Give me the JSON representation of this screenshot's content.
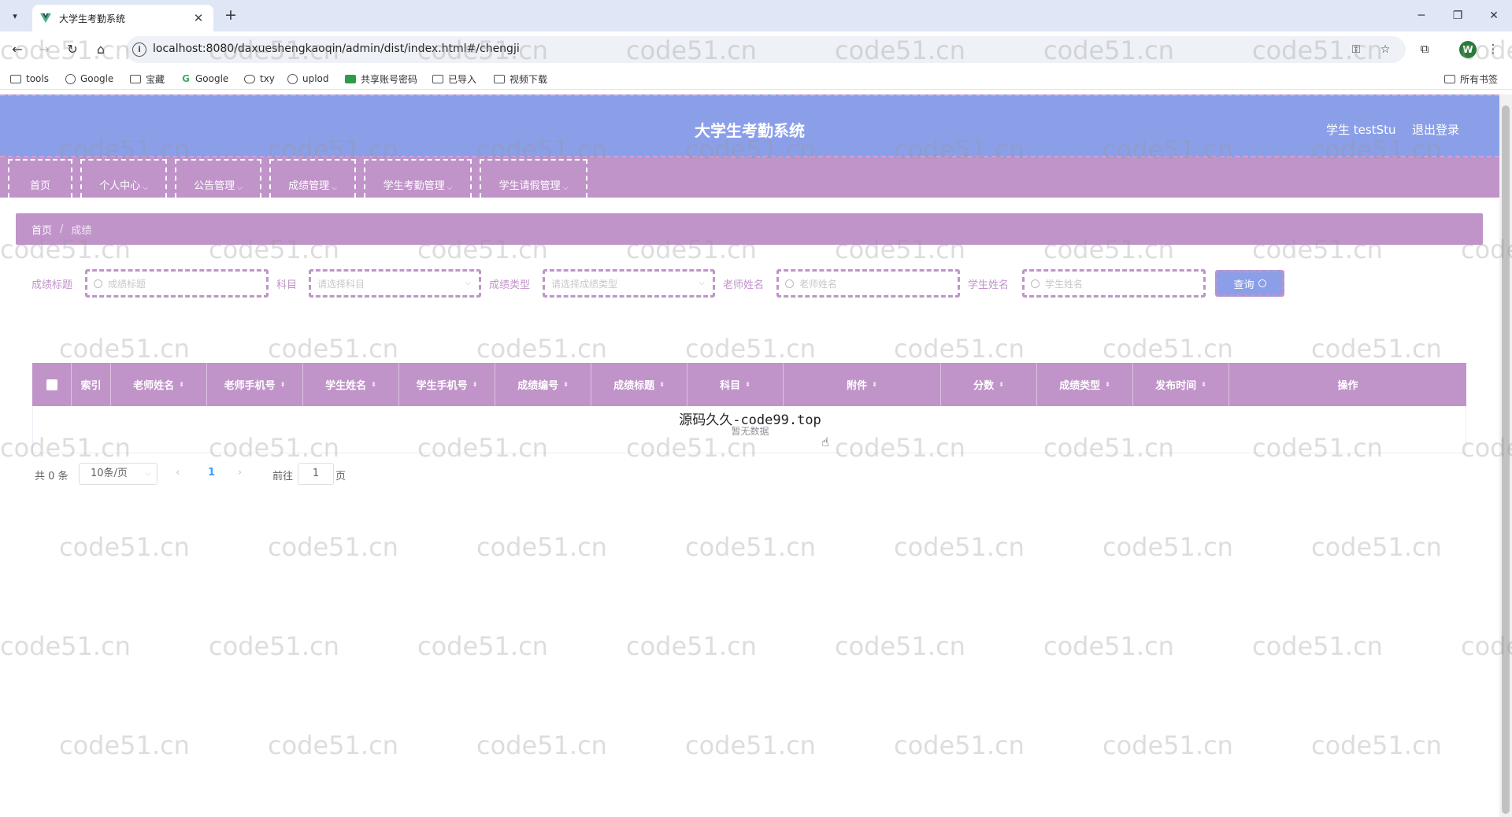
{
  "browser": {
    "tab_title": "大学生考勤系统",
    "url": "localhost:8080/daxueshengkaoqin/admin/dist/index.html#/chengji",
    "bookmarks": [
      "tools",
      "Google",
      "宝藏",
      "Google",
      "txy",
      "uplod",
      "共享账号密码",
      "已导入",
      "视频下载"
    ],
    "all_bookmarks": "所有书签",
    "profile_initial": "W"
  },
  "header": {
    "title": "大学生考勤系统",
    "user": "学生 testStu",
    "logout": "退出登录"
  },
  "menu": [
    "首页",
    "个人中心",
    "公告管理",
    "成绩管理",
    "学生考勤管理",
    "学生请假管理"
  ],
  "breadcrumb": {
    "home": "首页",
    "separator": "/",
    "current": "成绩"
  },
  "search": {
    "title_label": "成绩标题",
    "title_placeholder": "成绩标题",
    "subject_label": "科目",
    "subject_placeholder": "请选择科目",
    "type_label": "成绩类型",
    "type_placeholder": "请选择成绩类型",
    "teacher_label": "老师姓名",
    "teacher_placeholder": "老师姓名",
    "student_label": "学生姓名",
    "student_placeholder": "学生姓名",
    "button": "查询"
  },
  "table": {
    "columns": [
      "索引",
      "老师姓名",
      "老师手机号",
      "学生姓名",
      "学生手机号",
      "成绩编号",
      "成绩标题",
      "科目",
      "附件",
      "分数",
      "成绩类型",
      "发布时间",
      "操作"
    ],
    "overlay_text": "源码久久-code99.top",
    "empty_text": "暂无数据"
  },
  "pagination": {
    "total": "共 0 条",
    "page_size": "10条/页",
    "current_page": "1",
    "goto_label": "前往",
    "goto_value": "1",
    "page_suffix": "页"
  },
  "watermark": "code51.cn",
  "colors": {
    "header": "#8b9fe9",
    "menu": "#c094c9",
    "accent": "#409eff"
  }
}
